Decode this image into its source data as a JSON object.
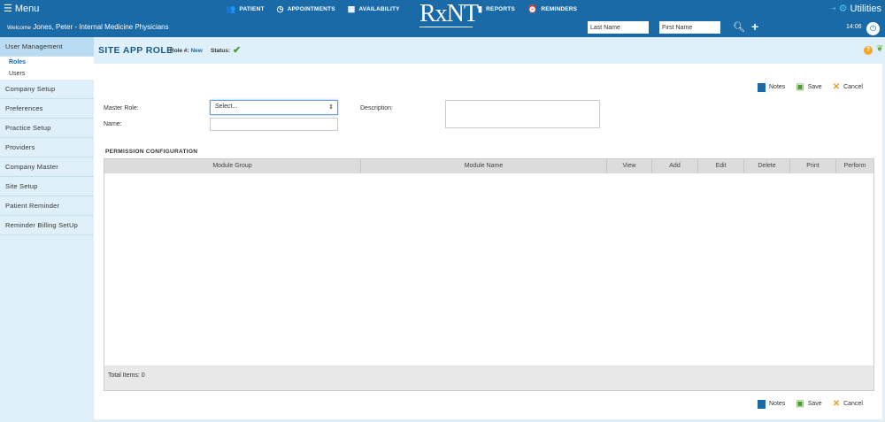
{
  "topbar": {
    "menu_label": "Menu",
    "welcome_prefix": "Welcome",
    "welcome_user": "Jones, Peter - Internal Medicine Physicians",
    "nav_left": [
      {
        "label": "PATIENT",
        "icon": "patient-icon"
      },
      {
        "label": "APPOINTMENTS",
        "icon": "clock-icon"
      },
      {
        "label": "AVAILABILITY",
        "icon": "calendar-icon"
      }
    ],
    "nav_right": [
      {
        "label": "REPORTS",
        "icon": "report-icon"
      },
      {
        "label": "REMINDERS",
        "icon": "alarm-icon"
      }
    ],
    "logo_text": "RxNT",
    "last_name_placeholder": "Last Name",
    "first_name_placeholder": "First Name",
    "utilities_label": "Utilities",
    "time": "14:06",
    "brand_color": "#1a6aa8"
  },
  "sidebar": {
    "items": [
      {
        "label": "User Management",
        "active": true
      },
      {
        "label": "Company Setup"
      },
      {
        "label": "Preferences"
      },
      {
        "label": "Practice Setup"
      },
      {
        "label": "Providers"
      },
      {
        "label": "Company Master"
      },
      {
        "label": "Site Setup"
      },
      {
        "label": "Patient Reminder"
      },
      {
        "label": "Reminder Billing SetUp"
      }
    ],
    "sub_items": [
      {
        "label": "Roles",
        "selected": true
      },
      {
        "label": "Users"
      }
    ]
  },
  "header": {
    "title": "SITE APP ROLE",
    "role_label": "Role #:",
    "role_value": "New",
    "status_label": "Status:"
  },
  "toolbar": {
    "notes_label": "Notes",
    "save_label": "Save",
    "cancel_label": "Cancel"
  },
  "form": {
    "master_role_label": "Master Role:",
    "master_role_value": "Select...",
    "name_label": "Name:",
    "description_label": "Description:"
  },
  "permissions": {
    "title": "PERMISSION CONFIGURATION",
    "columns": [
      "Module Group",
      "Module Name",
      "View",
      "Add",
      "Edit",
      "Delete",
      "Print",
      "Perform"
    ],
    "total_items": "Total Items: 0"
  }
}
